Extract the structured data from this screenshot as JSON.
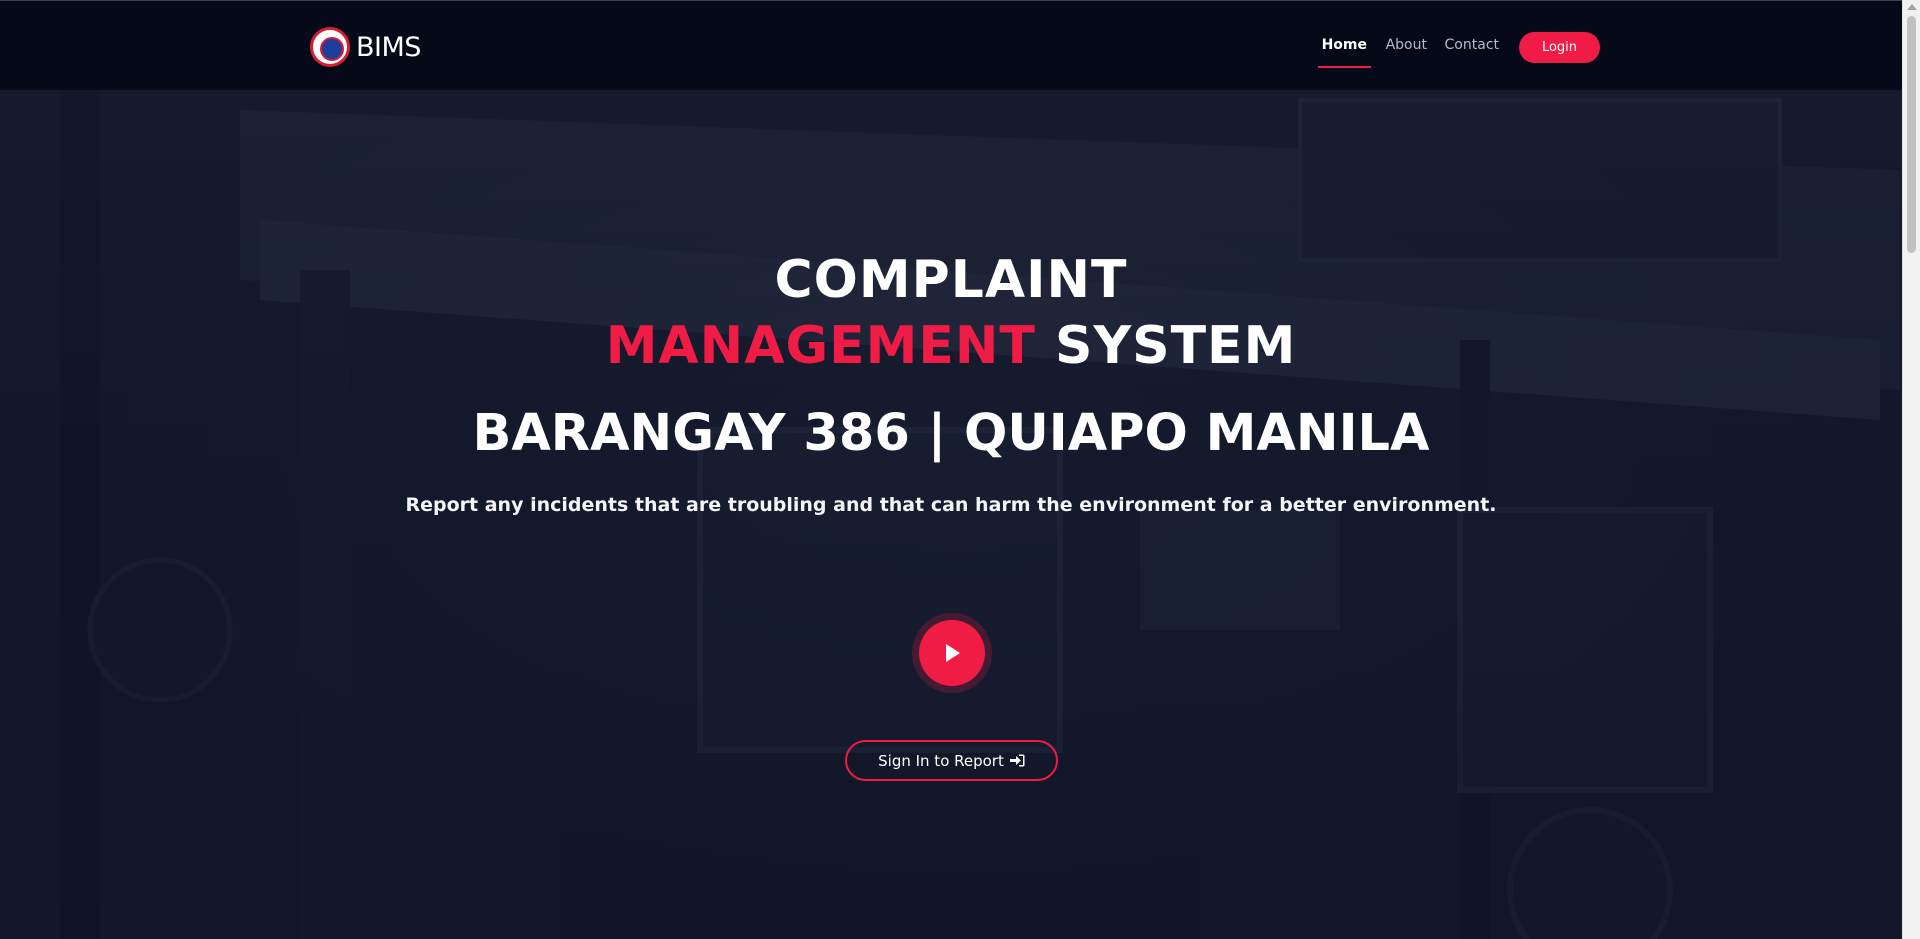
{
  "header": {
    "logo_text": "BIMS",
    "nav": [
      {
        "label": "Home"
      },
      {
        "label": "About"
      },
      {
        "label": "Contact"
      }
    ],
    "login_label": "Login"
  },
  "hero": {
    "title_line1": "COMPLAINT",
    "title_accent": "MANAGEMENT",
    "title_rest": "SYSTEM",
    "subtitle": "BARANGAY 386 | QUIAPO MANILA",
    "tagline": "Report any incidents that are troubling and that can harm the environment for a better environment.",
    "report_button_label": "Sign In to Report"
  },
  "colors": {
    "accent": "#f01c45",
    "header_bg": "#060a18",
    "hero_overlay": "#141a2e",
    "text": "#ffffff"
  },
  "icons": {
    "play": "play-icon",
    "sign_in": "sign-in-icon",
    "logo": "barangay-seal-icon"
  }
}
